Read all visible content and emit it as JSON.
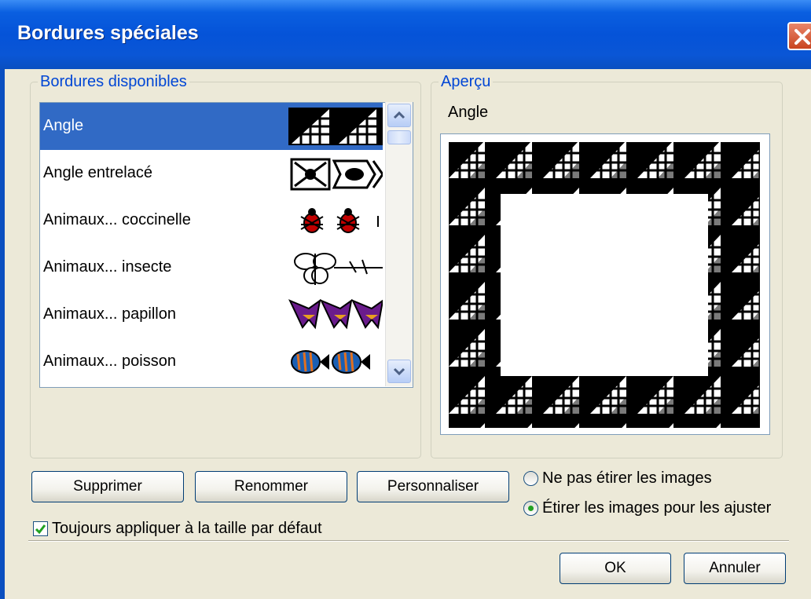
{
  "dialog": {
    "title": "Bordures spéciales"
  },
  "available": {
    "group_label": "Bordures disponibles",
    "items": [
      {
        "label": "Angle",
        "selected": true,
        "thumb": "angle"
      },
      {
        "label": "Angle entrelacé",
        "selected": false,
        "thumb": "angle-entrelace"
      },
      {
        "label": "Animaux... coccinelle",
        "selected": false,
        "thumb": "coccinelle"
      },
      {
        "label": "Animaux... insecte",
        "selected": false,
        "thumb": "insecte"
      },
      {
        "label": "Animaux... papillon",
        "selected": false,
        "thumb": "papillon"
      },
      {
        "label": "Animaux... poisson",
        "selected": false,
        "thumb": "poisson"
      }
    ]
  },
  "preview": {
    "group_label": "Aperçu",
    "name": "Angle"
  },
  "buttons": {
    "delete": "Supprimer",
    "rename": "Renommer",
    "customize": "Personnaliser",
    "ok": "OK",
    "cancel": "Annuler"
  },
  "stretch_options": [
    {
      "label": "Ne pas étirer les images",
      "selected": false
    },
    {
      "label": "Étirer les images pour les ajuster",
      "selected": true
    }
  ],
  "default_size_checkbox": {
    "label": "Toujours appliquer à la taille par défaut",
    "checked": true
  },
  "colors": {
    "title_bar": "#0553d8",
    "selection": "#316ac5",
    "group_label": "#0046d5",
    "dialog_bg": "#ece9d8"
  }
}
